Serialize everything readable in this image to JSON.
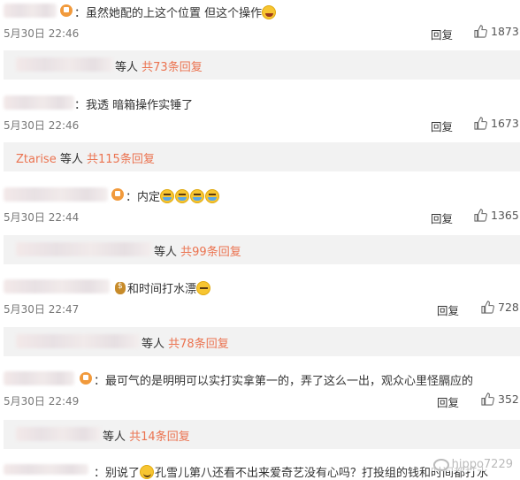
{
  "comments": [
    {
      "text": "：虽然她配的上这个位置 但这个操作",
      "emoji": "laugh",
      "time": "5月30日 22:46",
      "reply": "回复",
      "likes": "1873",
      "sub": {
        "prefix": "",
        "mid": "等人",
        "count": "共73条回复"
      }
    },
    {
      "text": "：我透 暗箱操作实锤了",
      "emoji": "",
      "time": "5月30日 22:46",
      "reply": "回复",
      "likes": "1673",
      "sub": {
        "prefix": "Ztarise",
        "mid": "等人",
        "count": "共115条回复"
      }
    },
    {
      "text": "：内定",
      "emoji": "cry",
      "time": "5月30日 22:44",
      "reply": "回复",
      "likes": "1365",
      "sub": {
        "prefix": "",
        "mid": "等人",
        "count": "共99条回复"
      }
    },
    {
      "text": "和时间打水漂",
      "emoji": "smug",
      "time": "5月30日 22:47",
      "reply": "回复",
      "likes": "728",
      "sub": {
        "prefix": "",
        "mid": "等人",
        "count": "共78条回复"
      }
    },
    {
      "text": "：最可气的是明明可以实打实拿第一的，弄了这么一出，观众心里怪膈应的",
      "emoji": "",
      "time": "5月30日 22:49",
      "reply": "回复",
      "likes": "352",
      "sub": {
        "prefix": "",
        "mid": "等人",
        "count": "共14条回复"
      }
    }
  ],
  "last_comment": {
    "text_a": "：别说了",
    "text_b": "孔雪儿第八还看不出来爱奇艺没有心吗？打投组的钱和时间都打水"
  },
  "watermark": "hippo7229"
}
